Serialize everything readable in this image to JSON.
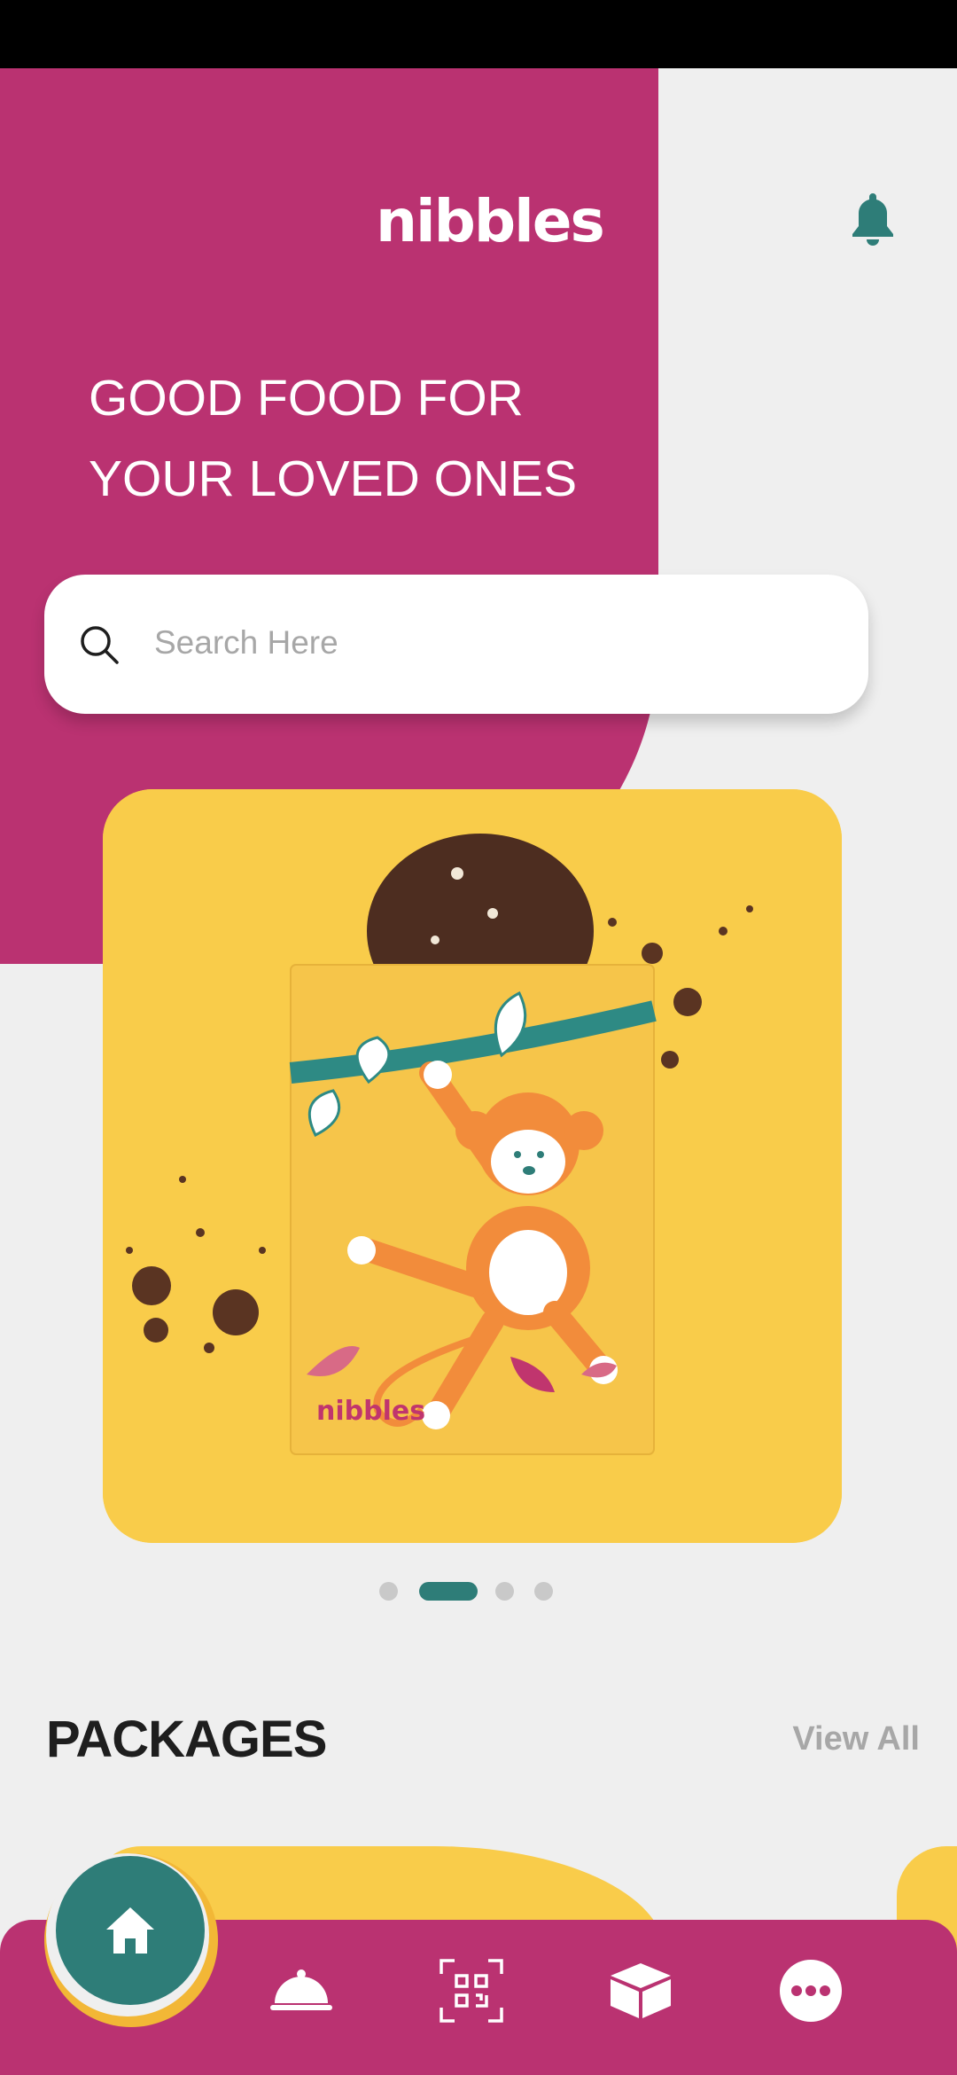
{
  "app": {
    "name": "nibbles",
    "brand_color": "#ba3271",
    "accent_color": "#2e7d78",
    "highlight_color": "#f9cc4a"
  },
  "header": {
    "logo_text": "nibbles",
    "notification_icon": "bell-icon"
  },
  "hero": {
    "headline_line1": "GOOD FOOD FOR",
    "headline_line2": "YOUR LOVED ONES"
  },
  "search": {
    "placeholder": "Search Here",
    "value": "",
    "icon": "search-icon"
  },
  "banner": {
    "image": "cookie-in-nibbles-monkey-bag",
    "bag_brand": "nibbles",
    "slide_count": 4,
    "active_slide": 2
  },
  "packages": {
    "title": "PACKAGES",
    "view_all_label": "View All"
  },
  "bottom_nav": {
    "items": [
      {
        "id": "home",
        "icon": "home-icon",
        "active": true
      },
      {
        "id": "menu",
        "icon": "cloche-icon",
        "active": false
      },
      {
        "id": "scan",
        "icon": "qr-scan-icon",
        "active": false
      },
      {
        "id": "orders",
        "icon": "box-icon",
        "active": false
      },
      {
        "id": "more",
        "icon": "more-icon",
        "active": false
      }
    ]
  }
}
